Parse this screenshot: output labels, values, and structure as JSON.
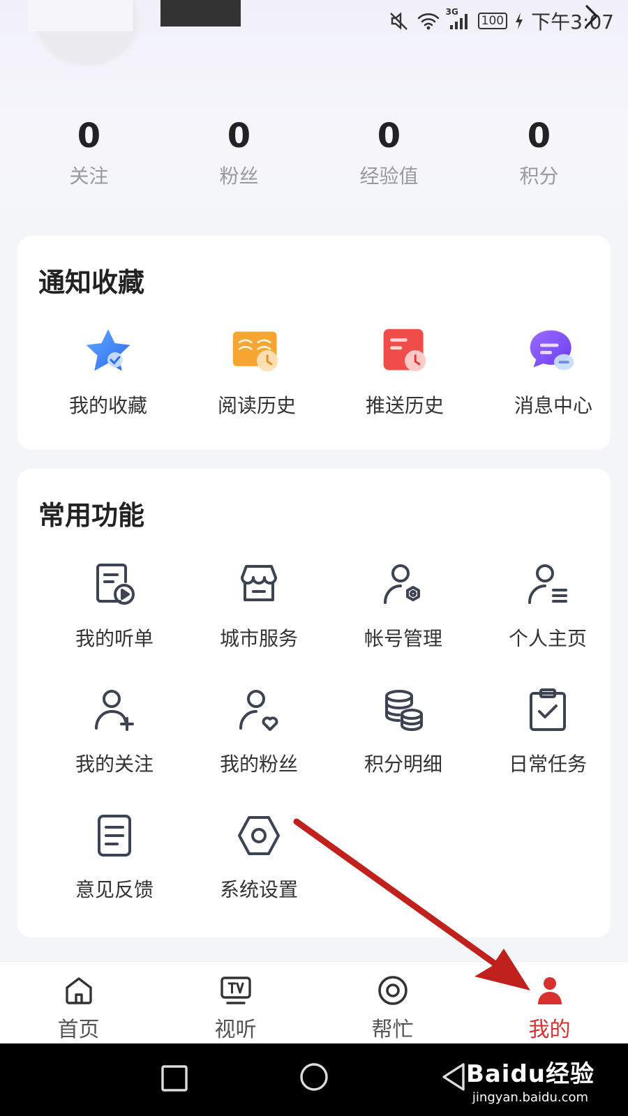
{
  "status_bar": {
    "battery": "100",
    "network": "3G",
    "time": "下午3:07"
  },
  "stats": [
    {
      "value": "0",
      "label": "关注"
    },
    {
      "value": "0",
      "label": "粉丝"
    },
    {
      "value": "0",
      "label": "经验值"
    },
    {
      "value": "0",
      "label": "积分"
    }
  ],
  "notify_card": {
    "title": "通知收藏",
    "items": [
      {
        "label": "我的收藏",
        "icon": "star-icon"
      },
      {
        "label": "阅读历史",
        "icon": "book-history-icon"
      },
      {
        "label": "推送历史",
        "icon": "push-history-icon"
      },
      {
        "label": "消息中心",
        "icon": "message-icon"
      }
    ]
  },
  "functions_card": {
    "title": "常用功能",
    "items": [
      {
        "label": "我的听单",
        "icon": "playlist-icon"
      },
      {
        "label": "城市服务",
        "icon": "store-icon"
      },
      {
        "label": "帐号管理",
        "icon": "account-settings-icon"
      },
      {
        "label": "个人主页",
        "icon": "profile-list-icon"
      },
      {
        "label": "我的关注",
        "icon": "user-add-icon"
      },
      {
        "label": "我的粉丝",
        "icon": "user-heart-icon"
      },
      {
        "label": "积分明细",
        "icon": "coins-icon"
      },
      {
        "label": "日常任务",
        "icon": "clipboard-check-icon"
      },
      {
        "label": "意见反馈",
        "icon": "feedback-doc-icon"
      },
      {
        "label": "系统设置",
        "icon": "settings-hex-icon"
      }
    ]
  },
  "bottom_nav": [
    {
      "label": "首页",
      "icon": "home-icon",
      "active": false
    },
    {
      "label": "视听",
      "icon": "tv-icon",
      "active": false
    },
    {
      "label": "帮忙",
      "icon": "target-icon",
      "active": false
    },
    {
      "label": "我的",
      "icon": "user-icon",
      "active": true
    }
  ],
  "watermark": {
    "logo": "Baidu经验",
    "url": "jingyan.baidu.com"
  },
  "colors": {
    "accent": "#d6302f",
    "arrow": "#c0211c",
    "icon_stroke": "#3c4352"
  }
}
